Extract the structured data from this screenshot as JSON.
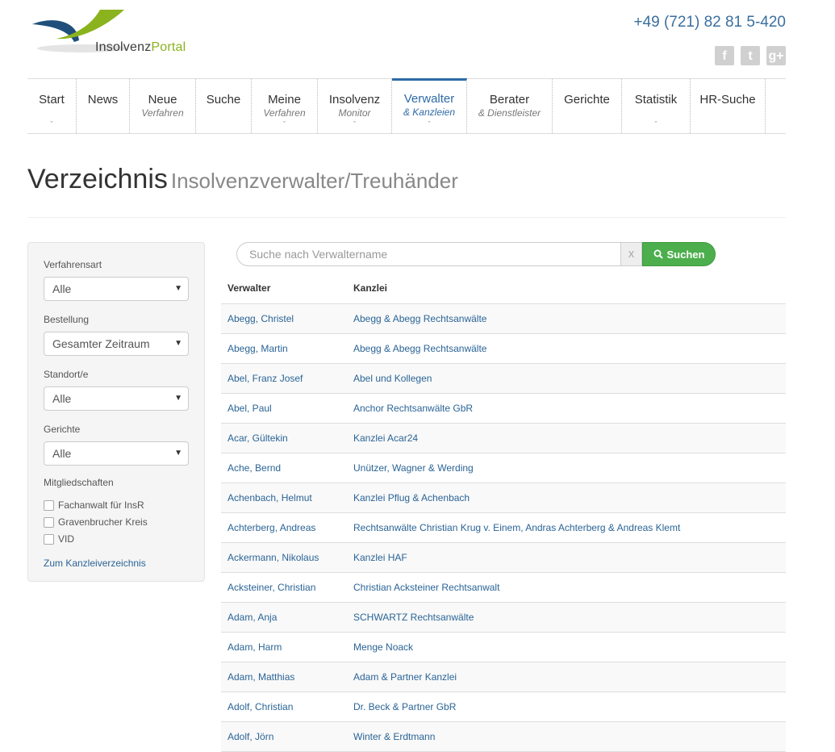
{
  "header": {
    "logo": {
      "part1": "Insolvenz",
      "part2": "Portal"
    },
    "phone": "+49 (721) 82 81 5-420",
    "social": [
      {
        "icon": "facebook-icon",
        "glyph": "f"
      },
      {
        "icon": "twitter-icon",
        "glyph": "t"
      },
      {
        "icon": "google-plus-icon",
        "glyph": "g+"
      }
    ]
  },
  "nav": [
    {
      "label": "Start",
      "sub": "",
      "chevron": true,
      "width": 61
    },
    {
      "label": "News",
      "sub": "",
      "chevron": false,
      "width": 66
    },
    {
      "label": "Neue",
      "sub": "Verfahren",
      "chevron": false,
      "width": 82
    },
    {
      "label": "Suche",
      "sub": "",
      "chevron": false,
      "width": 69
    },
    {
      "label": "Meine",
      "sub": "Verfahren",
      "chevron": true,
      "width": 82
    },
    {
      "label": "Insolvenz",
      "sub": "Monitor",
      "chevron": true,
      "width": 92
    },
    {
      "label": "Verwalter",
      "sub": "& Kanzleien",
      "chevron": true,
      "active": true,
      "width": 93
    },
    {
      "label": "Berater",
      "sub": "& Dienstleister",
      "chevron": false,
      "width": 106
    },
    {
      "label": "Gerichte",
      "sub": "",
      "chevron": false,
      "width": 86
    },
    {
      "label": "Statistik",
      "sub": "",
      "chevron": true,
      "width": 85
    },
    {
      "label": "HR-Suche",
      "sub": "",
      "chevron": false,
      "width": 93
    }
  ],
  "page": {
    "title": "Verzeichnis",
    "subtitle": "Insolvenzverwalter/Treuhänder"
  },
  "sidebar": {
    "filters": [
      {
        "label": "Verfahrensart",
        "value": "Alle"
      },
      {
        "label": "Bestellung",
        "value": "Gesamter Zeitraum"
      },
      {
        "label": "Standort/e",
        "value": "Alle"
      },
      {
        "label": "Gerichte",
        "value": "Alle"
      }
    ],
    "memberships_label": "Mitgliedschaften",
    "memberships": [
      "Fachanwalt für InsR",
      "Gravenbrucher Kreis",
      "VID"
    ],
    "link": "Zum Kanzleiverzeichnis"
  },
  "search": {
    "placeholder": "Suche nach Verwaltername",
    "clear": "x",
    "button": "Suchen"
  },
  "table": {
    "headers": [
      "Verwalter",
      "Kanzlei"
    ],
    "rows": [
      [
        "Abegg, Christel",
        "Abegg & Abegg Rechtsanwälte"
      ],
      [
        "Abegg, Martin",
        "Abegg & Abegg Rechtsanwälte"
      ],
      [
        "Abel, Franz Josef",
        "Abel und Kollegen"
      ],
      [
        "Abel, Paul",
        "Anchor Rechtsanwälte GbR"
      ],
      [
        "Acar, Gültekin",
        "Kanzlei Acar24"
      ],
      [
        "Ache, Bernd",
        "Unützer, Wagner & Werding"
      ],
      [
        "Achenbach, Helmut",
        "Kanzlei Pflug & Achenbach"
      ],
      [
        "Achterberg, Andreas",
        "Rechtsanwälte Christian Krug v. Einem, Andras Achterberg & Andreas Klemt"
      ],
      [
        "Ackermann, Nikolaus",
        "Kanzlei HAF"
      ],
      [
        "Acksteiner, Christian",
        "Christian Acksteiner Rechtsanwalt"
      ],
      [
        "Adam, Anja",
        "SCHWARTZ Rechtsanwälte"
      ],
      [
        "Adam, Harm",
        "Menge Noack"
      ],
      [
        "Adam, Matthias",
        "Adam & Partner Kanzlei"
      ],
      [
        "Adolf, Christian",
        "Dr. Beck & Partner GbR"
      ],
      [
        "Adolf, Jörn",
        "Winter & Erdtmann"
      ]
    ]
  }
}
